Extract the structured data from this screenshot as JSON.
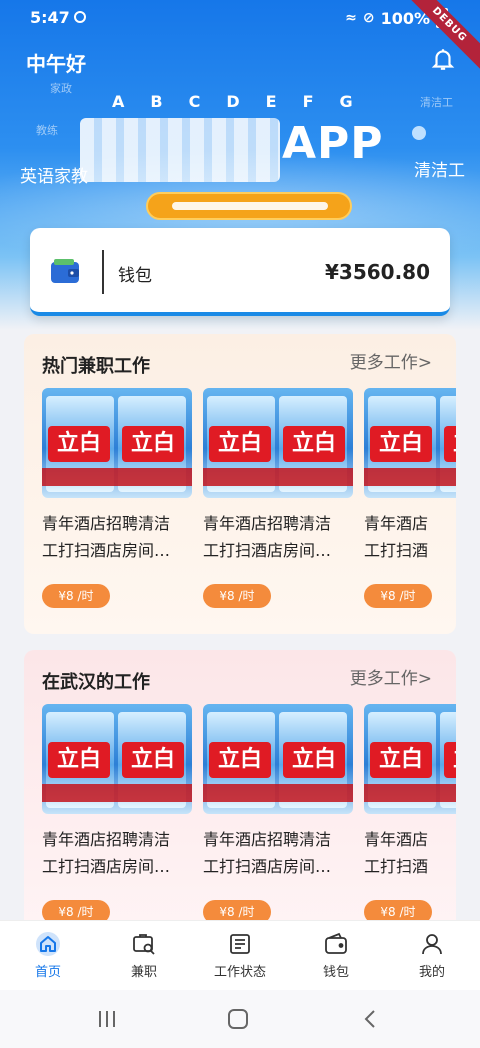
{
  "status_bar": {
    "time": "5:47",
    "battery": "100%",
    "debug": "DEBUG"
  },
  "header": {
    "greeting": "中午好"
  },
  "banner": {
    "letters": [
      "A",
      "B",
      "C",
      "D",
      "E",
      "F",
      "G"
    ],
    "faint_left": "教练",
    "faint_top_left": "家政",
    "faint_right": "清洁工",
    "side_left": "英语家教",
    "side_right": "清洁工",
    "title_suffix": "APP"
  },
  "wallet": {
    "label": "钱包",
    "balance": "¥3560.80"
  },
  "hot_section": {
    "title": "热门兼职工作",
    "more": "更多工作>",
    "items": [
      {
        "brand": "立白",
        "title_line1": "青年酒店招聘清洁",
        "title_line2": "工打扫酒店房间…",
        "price": "¥8 /时"
      },
      {
        "brand": "立白",
        "title_line1": "青年酒店招聘清洁",
        "title_line2": "工打扫酒店房间…",
        "price": "¥8 /时"
      },
      {
        "brand": "立白",
        "title_line1": "青年酒店",
        "title_line2": "工打扫酒",
        "price": "¥8 /时"
      }
    ]
  },
  "wuhan_section": {
    "title": "在武汉的工作",
    "more": "更多工作>",
    "items": [
      {
        "brand": "立白",
        "title_line1": "青年酒店招聘清洁",
        "title_line2": "工打扫酒店房间…",
        "price": "¥8 /时"
      },
      {
        "brand": "立白",
        "title_line1": "青年酒店招聘清洁",
        "title_line2": "工打扫酒店房间…",
        "price": "¥8 /时"
      },
      {
        "brand": "立白",
        "title_line1": "青年酒店",
        "title_line2": "工打扫酒",
        "price": "¥8 /时"
      }
    ]
  },
  "nav": {
    "items": [
      {
        "label": "首页",
        "icon": "home-icon",
        "active": true
      },
      {
        "label": "兼职",
        "icon": "job-search-icon",
        "active": false
      },
      {
        "label": "工作状态",
        "icon": "work-status-icon",
        "active": false
      },
      {
        "label": "钱包",
        "icon": "wallet-icon",
        "active": false
      },
      {
        "label": "我的",
        "icon": "profile-icon",
        "active": false
      }
    ]
  },
  "colors": {
    "primary": "#1677e9",
    "accent": "#f48b3c",
    "pill": "#f5a31a",
    "brand_red": "#e01b24"
  }
}
